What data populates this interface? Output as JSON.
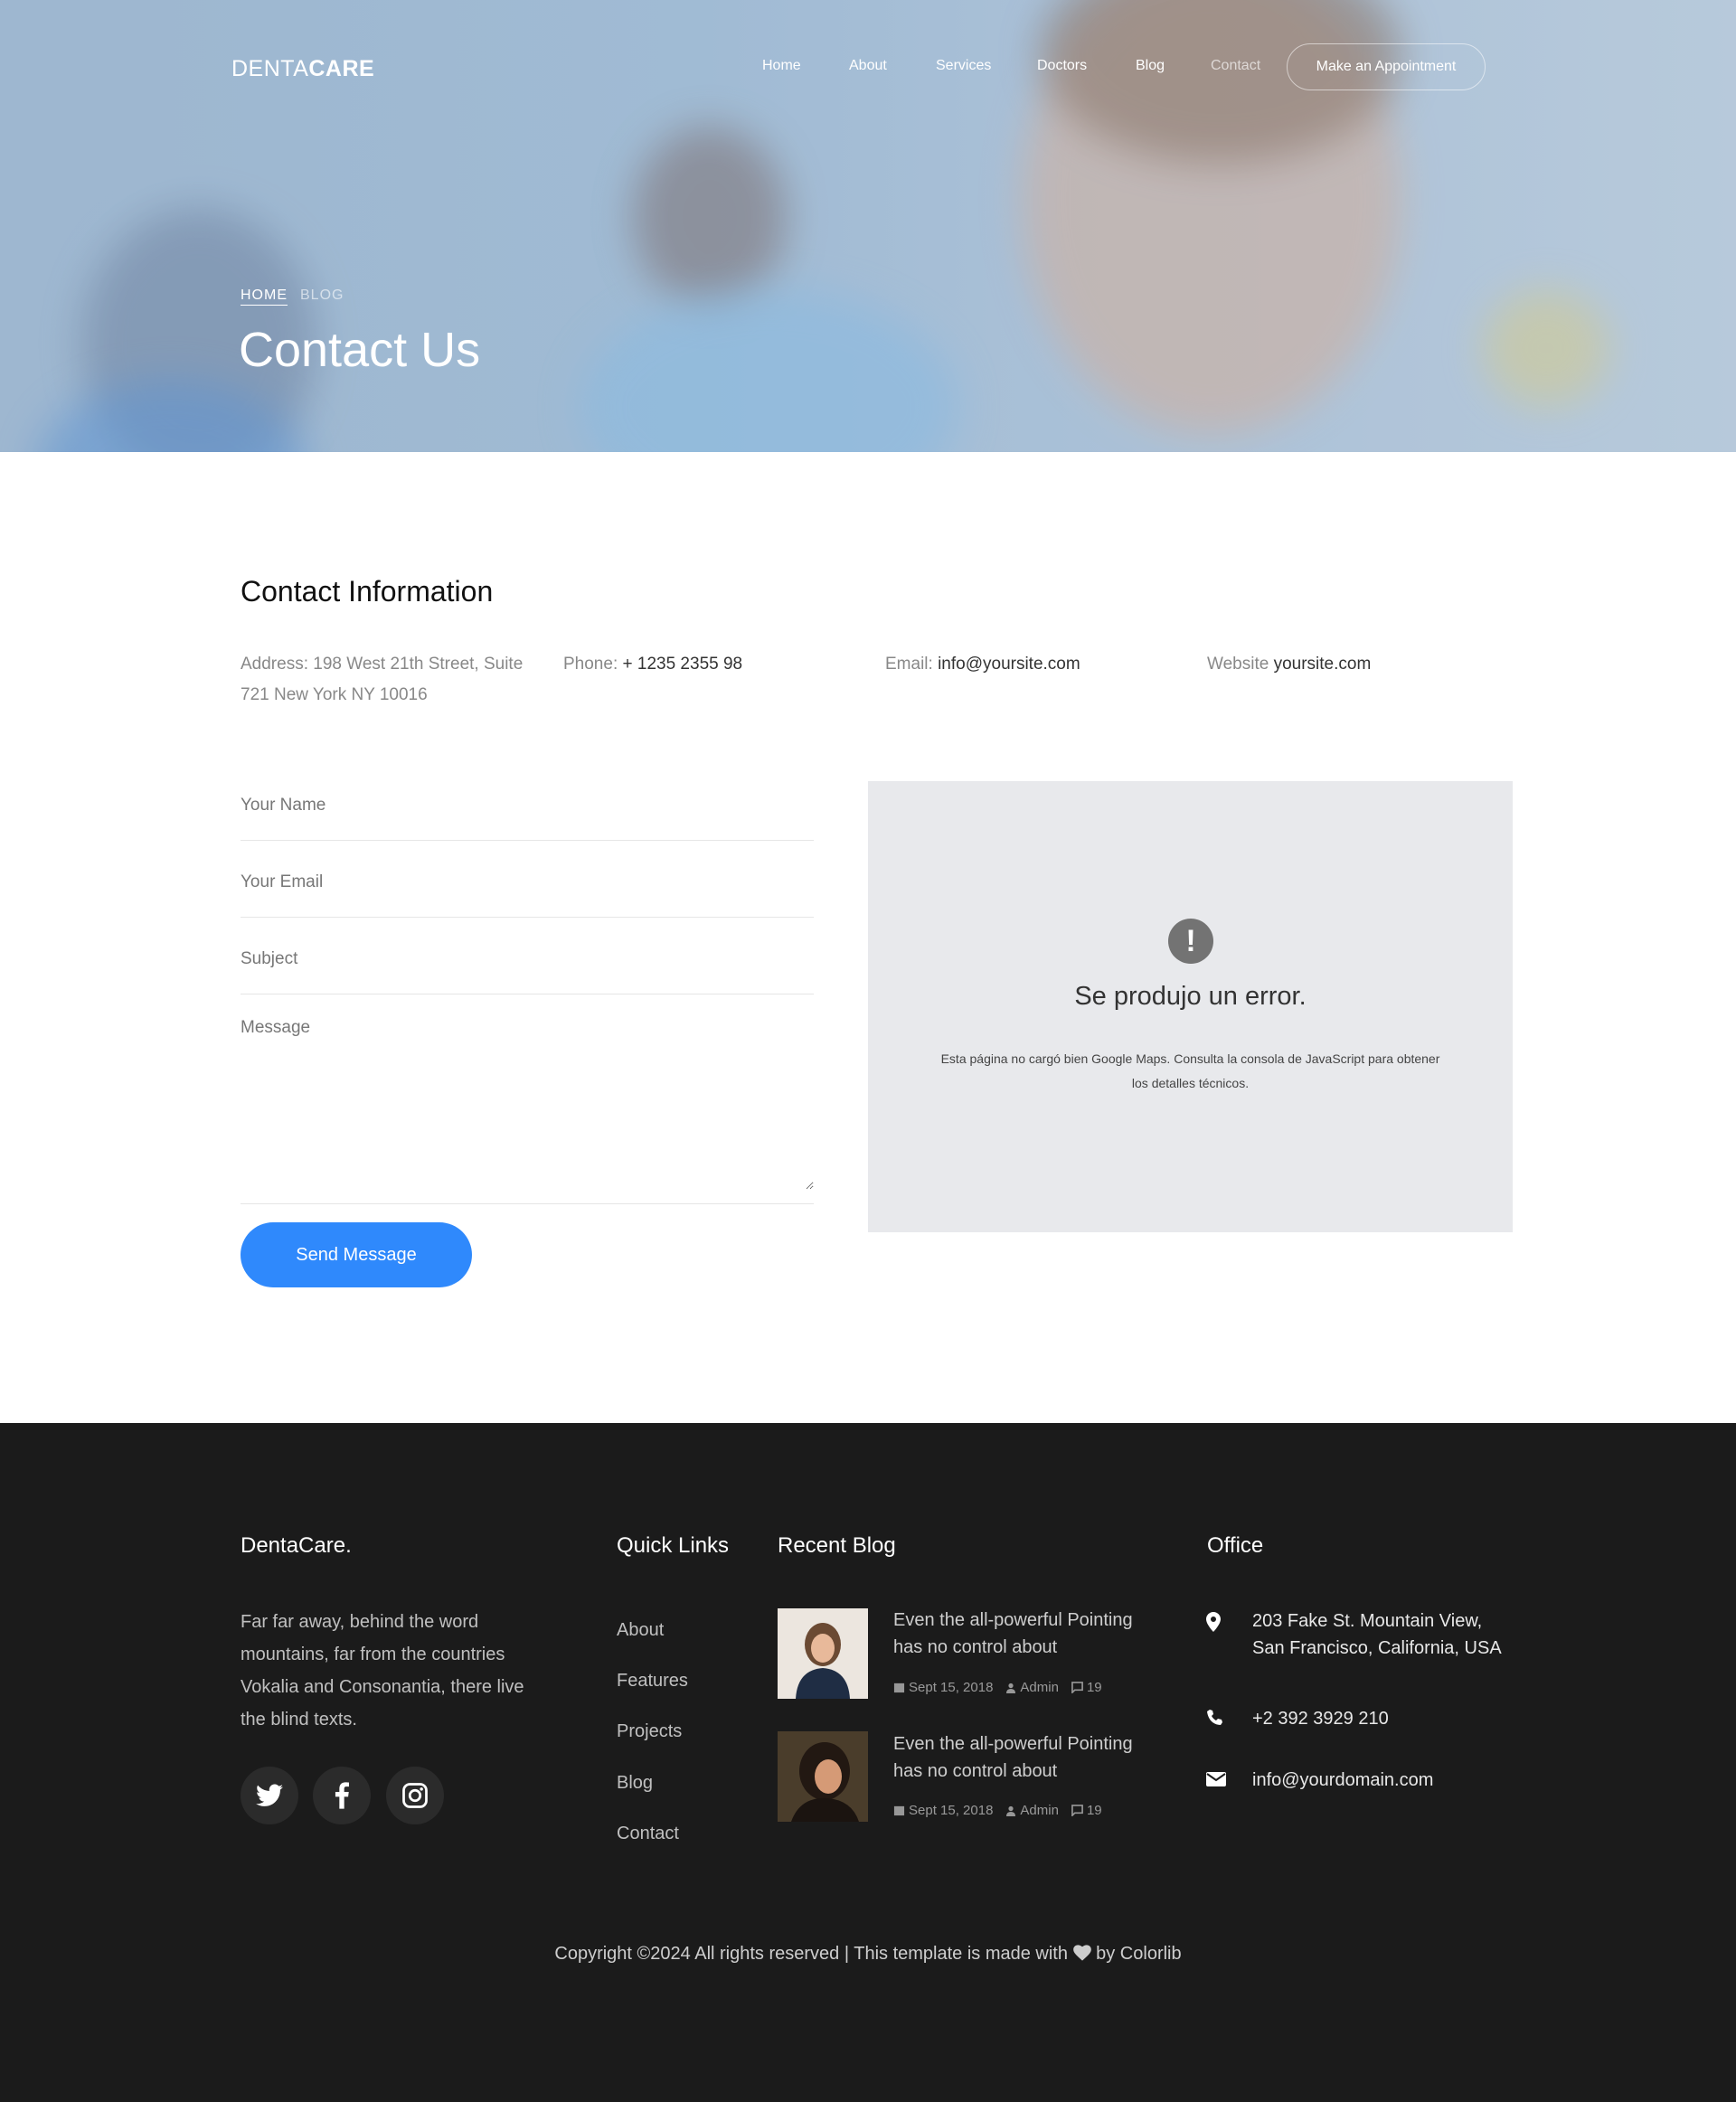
{
  "nav": {
    "logo_light": "DENTA",
    "logo_bold": "CARE",
    "items": [
      "Home",
      "About",
      "Services",
      "Doctors",
      "Blog",
      "Contact"
    ],
    "cta": "Make an Appointment"
  },
  "hero": {
    "breadcrumb_home": "HOME",
    "breadcrumb_current": "BLOG",
    "title": "Contact Us"
  },
  "contact": {
    "title": "Contact Information",
    "address_label": "Address:",
    "address_value": "198 West 21th Street, Suite 721 New York NY 10016",
    "phone_label": "Phone:",
    "phone_value": "+ 1235 2355 98",
    "email_label": "Email:",
    "email_value": "info@yoursite.com",
    "website_label": "Website",
    "website_value": "yoursite.com"
  },
  "form": {
    "name_placeholder": "Your Name",
    "email_placeholder": "Your Email",
    "subject_placeholder": "Subject",
    "message_placeholder": "Message",
    "submit_label": "Send Message"
  },
  "map_error": {
    "icon_glyph": "!",
    "title": "Se produjo un error.",
    "text": "Esta página no cargó bien Google Maps. Consulta la consola de JavaScript para obtener los detalles técnicos."
  },
  "footer": {
    "brand": "DentaCare.",
    "about_text": "Far far away, behind the word mountains, far from the countries Vokalia and Consonantia, there live the blind texts.",
    "social_icons": [
      "twitter-icon",
      "facebook-icon",
      "instagram-icon"
    ],
    "quick_links_title": "Quick Links",
    "quick_links": [
      "About",
      "Features",
      "Projects",
      "Blog",
      "Contact"
    ],
    "recent_blog_title": "Recent Blog",
    "blog_posts": [
      {
        "title": "Even the all-powerful Pointing has no control about",
        "date": "Sept 15, 2018",
        "author": "Admin",
        "comments": "19"
      },
      {
        "title": "Even the all-powerful Pointing has no control about",
        "date": "Sept 15, 2018",
        "author": "Admin",
        "comments": "19"
      }
    ],
    "office_title": "Office",
    "office_address": "203 Fake St. Mountain View, San Francisco, California, USA",
    "office_phone": "+2 392 3929 210",
    "office_email": "info@yourdomain.com",
    "copyright_pre": "Copyright ©2024 All rights reserved | This template is made with",
    "copyright_post": "by Colorlib"
  },
  "colors": {
    "accent": "#2f89fc",
    "footer_bg": "#1b1b1b",
    "map_bg": "#e8e9ec"
  }
}
